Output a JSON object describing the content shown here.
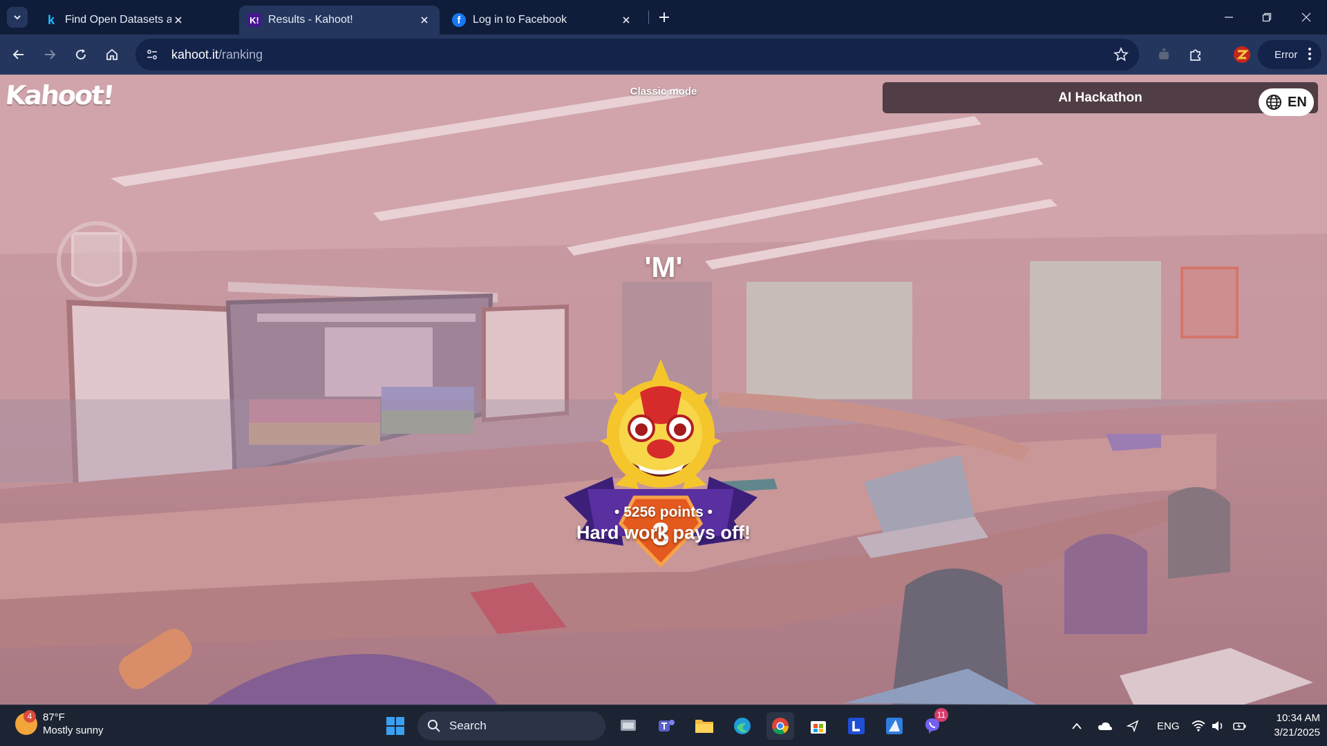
{
  "browser": {
    "tabs": [
      {
        "title": "Find Open Datasets and Machine Learning Projects | Kaggle",
        "favicon": "kaggle-icon",
        "active": false
      },
      {
        "title": "Results - Kahoot!",
        "favicon": "kahoot-icon",
        "active": true
      },
      {
        "title": "Log in to Facebook",
        "favicon": "facebook-icon",
        "active": false
      }
    ],
    "url": {
      "host": "kahoot.it",
      "path": "/ranking"
    },
    "profile_status": "Error"
  },
  "kahoot": {
    "logo_text": "Kahoot!",
    "mode_label": "Classic mode",
    "quiz_title": "AI Hackathon",
    "language": "EN",
    "player_name": "'M'",
    "rank": "3",
    "points_text": "• 5256 points •",
    "message": "Hard work pays off!"
  },
  "taskbar": {
    "weather": {
      "temp": "87°F",
      "condition": "Mostly sunny",
      "alert_count": "4"
    },
    "search_label": "Search",
    "apps": [
      "windows-start-icon",
      "task-view-icon",
      "teams-icon",
      "file-explorer-icon",
      "edge-icon",
      "chrome-icon",
      "microsoft-store-icon",
      "l-app-icon",
      "azure-icon",
      "viber-icon"
    ],
    "notification_badge": "11",
    "tray": {
      "language": "ENG"
    },
    "clock": {
      "time": "10:34 AM",
      "date": "3/21/2025"
    }
  },
  "colors": {
    "chrome_dark": "#0f1d3a",
    "chrome_mid": "#24365e",
    "ribbon_purple": "#4a2a8c",
    "rank_orange": "#e45a1e",
    "taskbar": "#1c2433"
  }
}
